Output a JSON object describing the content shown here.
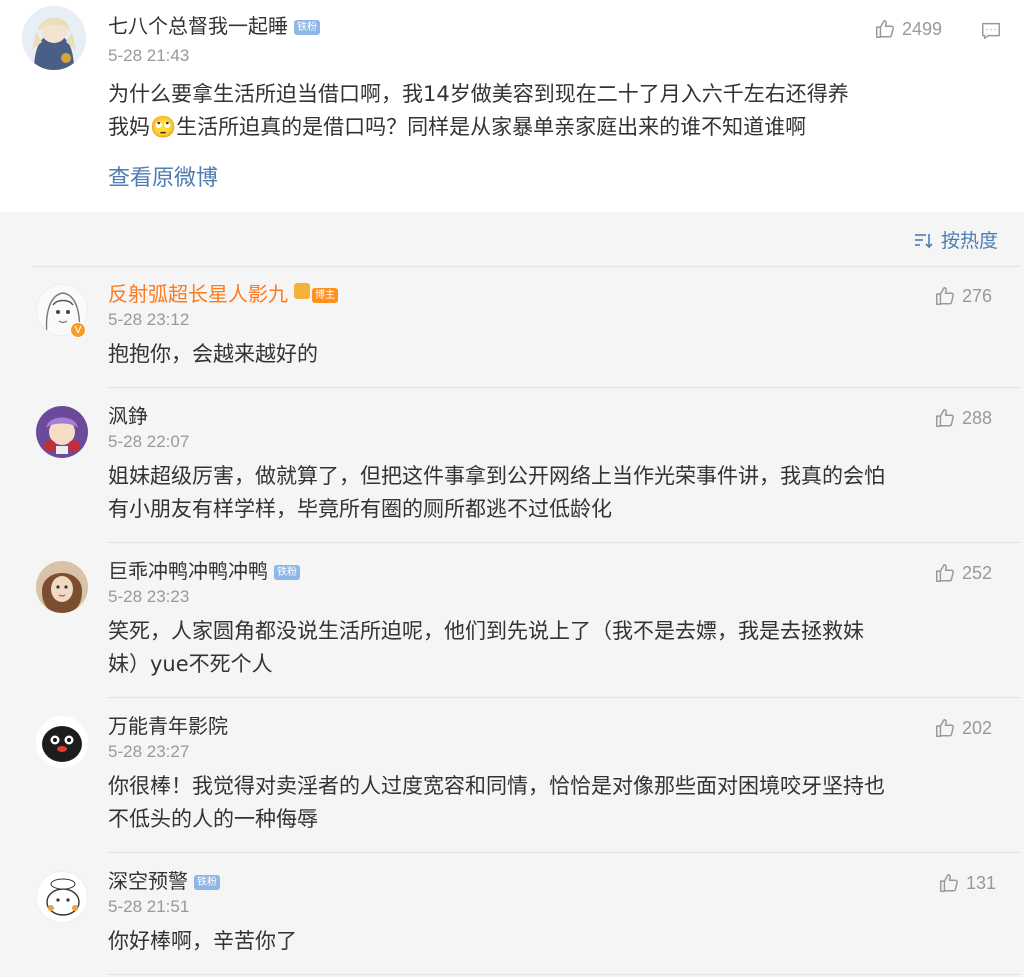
{
  "main_post": {
    "nickname": "七八个总督我一起睡",
    "badge": "铁粉",
    "time": "5-28 21:43",
    "likes": "2499",
    "content_line1": "为什么要拿生活所迫当借口啊，我14岁做美容到现在二十了月入六千左右还得养",
    "content_line2": "我妈🙄生活所迫真的是借口吗？同样是从家暴单亲家庭出来的谁不知道谁啊",
    "view_original": "查看原微博"
  },
  "sort": {
    "label": "按热度"
  },
  "comments": [
    {
      "nickname": "反射弧超长星人影九",
      "badge": "博主",
      "time": "5-28 23:12",
      "likes": "276",
      "line1": "抱抱你，会越来越好的",
      "line2": "",
      "nick_color": "#ff7a1a"
    },
    {
      "nickname": "沨錚",
      "badge": "",
      "time": "5-28 22:07",
      "likes": "288",
      "line1": "姐妹超级厉害，做就算了，但把这件事拿到公开网络上当作光荣事件讲，我真的会怕",
      "line2": "有小朋友有样学样，毕竟所有圈的厕所都逃不过低龄化",
      "nick_color": "#333333"
    },
    {
      "nickname": "巨乖冲鸭冲鸭冲鸭",
      "badge": "铁粉",
      "time": "5-28 23:23",
      "likes": "252",
      "line1": "笑死，人家圆角都没说生活所迫呢，他们到先说上了（我不是去嫖，我是去拯救妹",
      "line2": "妹）yue不死个人",
      "nick_color": "#333333"
    },
    {
      "nickname": "万能青年影院",
      "badge": "",
      "time": "5-28 23:27",
      "likes": "202",
      "line1": "你很棒！我觉得对卖淫者的人过度宽容和同情，恰恰是对像那些面对困境咬牙坚持也",
      "line2": "不低头的人的一种侮辱",
      "nick_color": "#333333"
    },
    {
      "nickname": "深空预警",
      "badge": "铁粉",
      "time": "5-28 21:51",
      "likes": "131",
      "line1": "你好棒啊，辛苦你了",
      "line2": "",
      "nick_color": "#333333"
    }
  ],
  "colors": {
    "link": "#4f7cb1",
    "owner": "#ff7a1a",
    "fan_badge": "#8eb6e6"
  }
}
